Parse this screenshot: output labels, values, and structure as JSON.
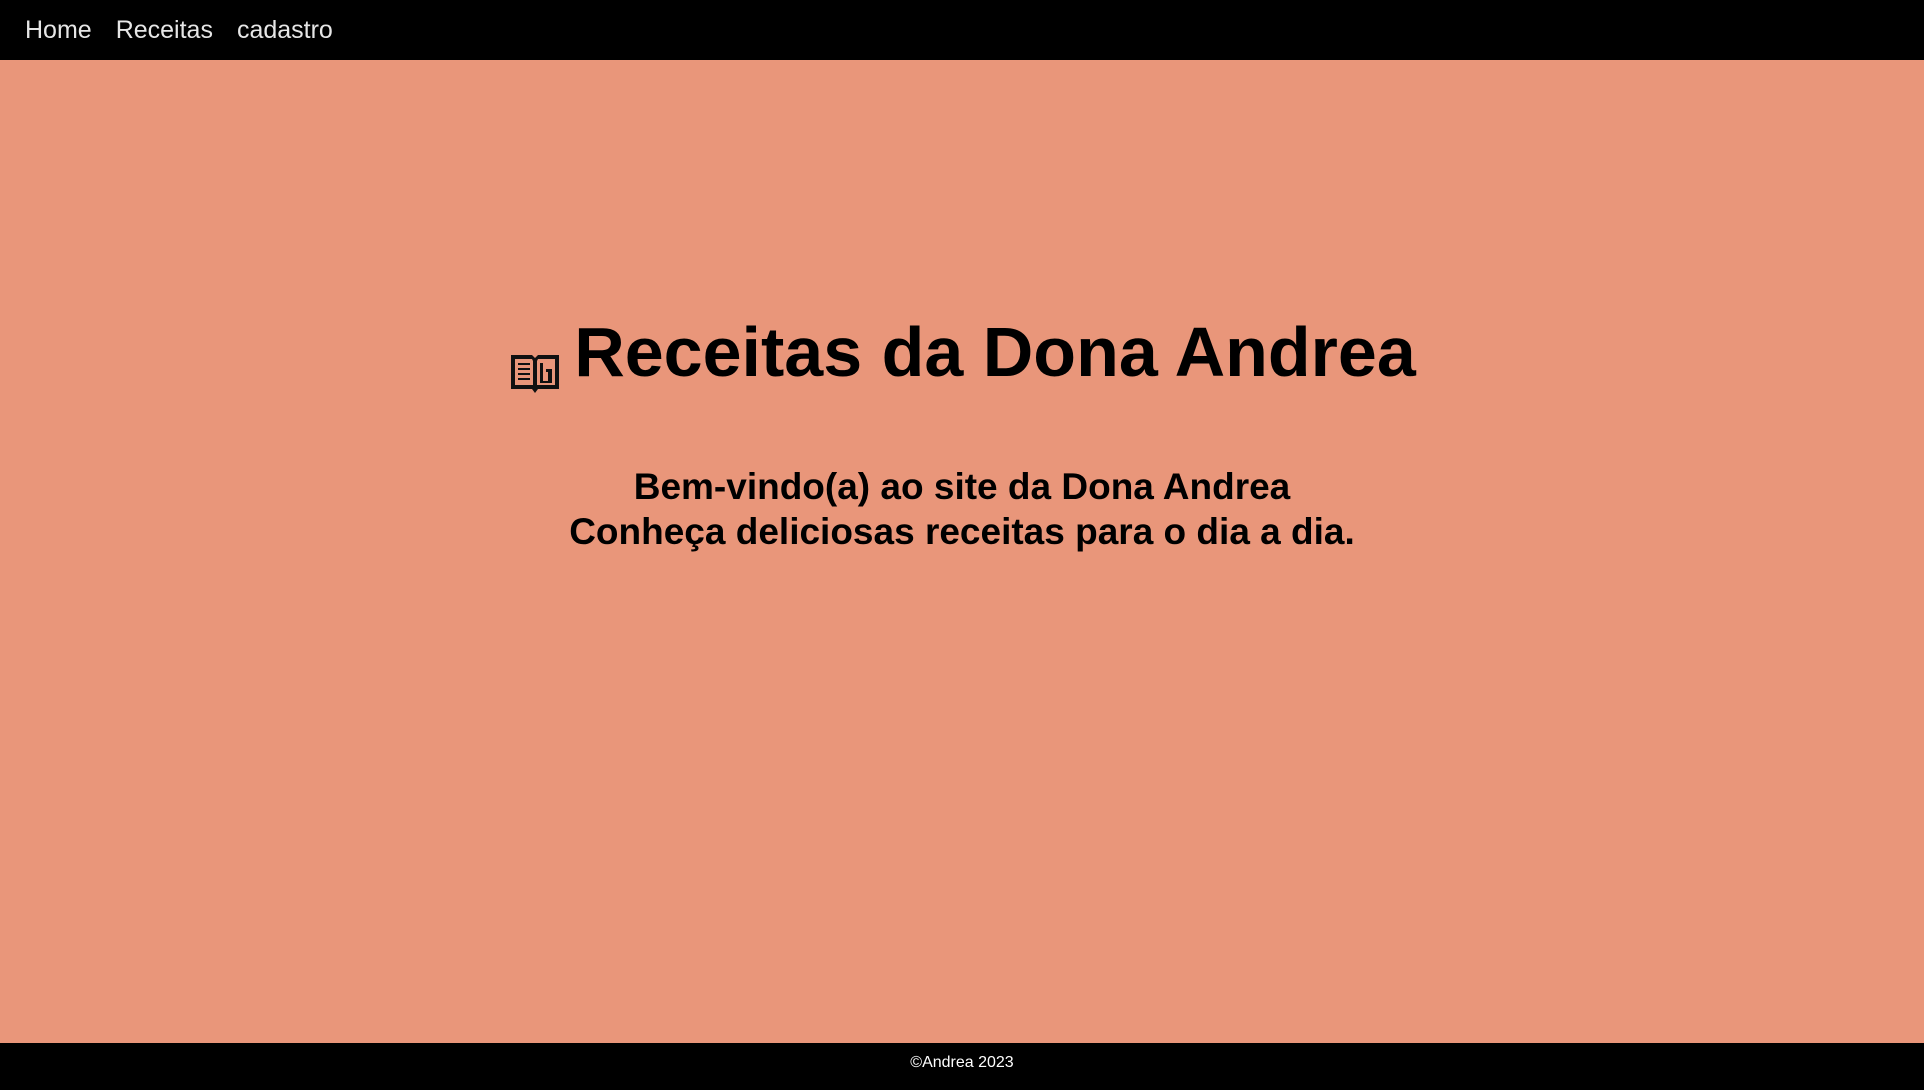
{
  "nav": {
    "items": [
      {
        "label": "Home"
      },
      {
        "label": "Receitas"
      },
      {
        "label": "cadastro"
      }
    ]
  },
  "hero": {
    "icon": "open-book-icon",
    "title": "Receitas da Dona Andrea"
  },
  "welcome": {
    "line1": "Bem-vindo(a) ao site da Dona Andrea",
    "line2": "Conheça deliciosas receitas para o dia a dia."
  },
  "footer": {
    "text": "©Andrea 2023"
  },
  "colors": {
    "background": "#e9967a",
    "nav_background": "#000000",
    "footer_background": "#000000",
    "nav_text": "#e6e6e6",
    "heading_text": "#000000"
  }
}
